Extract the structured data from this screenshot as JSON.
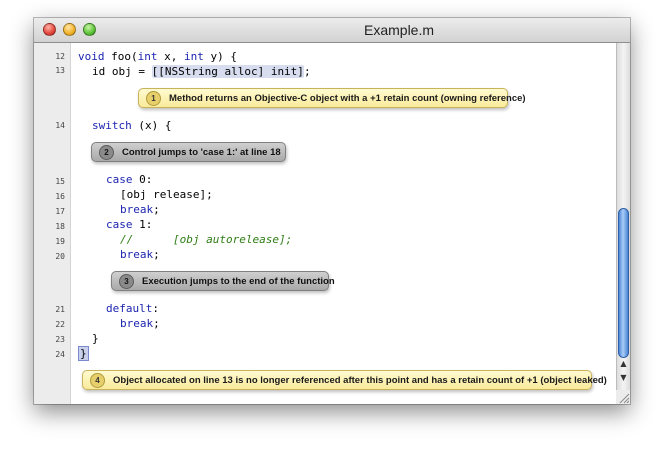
{
  "window": {
    "title": "Example.m"
  },
  "gutter_lines": [
    "12",
    "13",
    "14",
    "15",
    "16",
    "17",
    "18",
    "19",
    "20",
    "21",
    "22",
    "23",
    "24"
  ],
  "code": {
    "l12": {
      "kw1": "void",
      "t1": " foo(",
      "kw2": "int",
      "t2": " x, ",
      "kw3": "int",
      "t3": " y) {"
    },
    "l13": {
      "prefix": "id obj = ",
      "highlight": "[[NSString alloc] init]",
      "suffix": ";"
    },
    "l14": {
      "kw": "switch",
      "rest": " (x) {"
    },
    "l15": {
      "kw": "case",
      "rest": " 0:"
    },
    "l16": "[obj release];",
    "l17": {
      "kw": "break",
      "rest": ";"
    },
    "l18": {
      "kw": "case",
      "rest": " 1:"
    },
    "l19": "//      [obj autorelease];",
    "l20": {
      "kw": "break",
      "rest": ";"
    },
    "l21": {
      "kw": "default",
      "rest": ":"
    },
    "l22": {
      "kw": "break",
      "rest": ";"
    },
    "l23": "}",
    "l24": "}"
  },
  "annotations": [
    {
      "number": "1",
      "text": "Method returns an Objective-C object with a +1 retain count (owning reference)"
    },
    {
      "number": "2",
      "text": "Control jumps to 'case 1:'  at line 18"
    },
    {
      "number": "3",
      "text": "Execution jumps to the end of the function"
    },
    {
      "number": "4",
      "text": "Object allocated on line 13 is no longer referenced after this point and has a retain count of +1 (object leaked)"
    }
  ],
  "scrollbar": {
    "up_arrow": "▲",
    "down_arrow": "▼"
  },
  "colors": {
    "keyword": "#1c25b0",
    "comment": "#2e7d14",
    "event_bubble": "#f9ea9a",
    "control_bubble": "#a9a9a9",
    "scroll_thumb": "#4f86d8"
  }
}
